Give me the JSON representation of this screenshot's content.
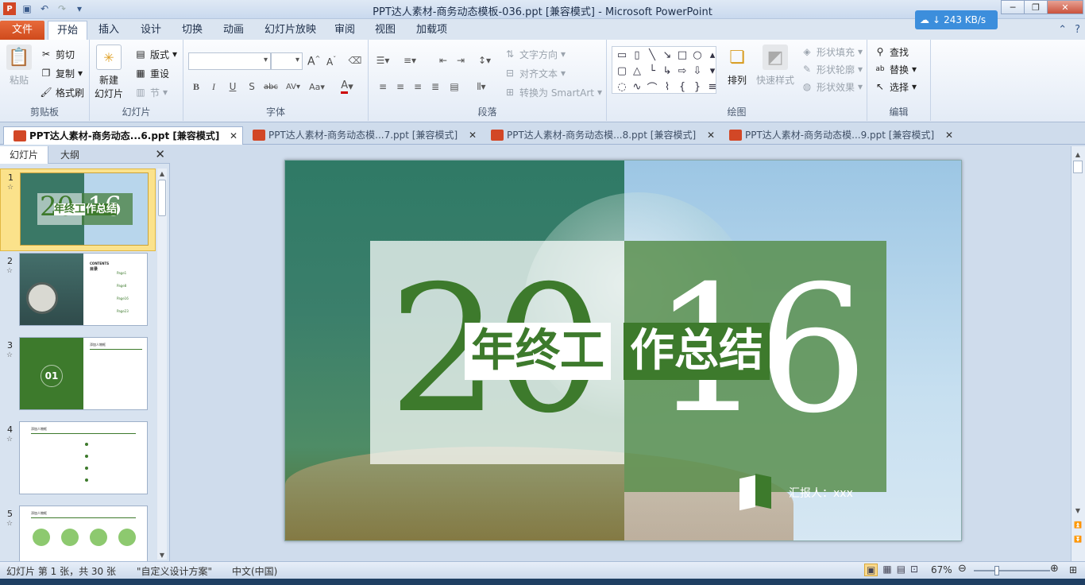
{
  "window": {
    "title": "PPT达人素材-商务动态模板-036.ppt [兼容模式]  -  Microsoft PowerPoint",
    "net_speed": "243 KB/s",
    "buttons": {
      "minimize": "─",
      "maximize": "❐",
      "close": "✕"
    }
  },
  "ribbon_tabs": [
    "文件",
    "开始",
    "插入",
    "设计",
    "切换",
    "动画",
    "幻灯片放映",
    "审阅",
    "视图",
    "加载项"
  ],
  "ribbon": {
    "clipboard": {
      "label": "剪贴板",
      "paste": "粘贴",
      "cut": "剪切",
      "copy": "复制",
      "format_painter": "格式刷"
    },
    "slides": {
      "label": "幻灯片",
      "new_slide": "新建\n幻灯片",
      "layout": "版式",
      "reset": "重设",
      "section": "节"
    },
    "font": {
      "label": "字体"
    },
    "paragraph": {
      "label": "段落",
      "text_direction": "文字方向",
      "align_text": "对齐文本",
      "smartart": "转换为 SmartArt"
    },
    "drawing": {
      "label": "绘图",
      "arrange": "排列",
      "quick_styles": "快速样式",
      "shape_fill": "形状填充",
      "shape_outline": "形状轮廓",
      "shape_effects": "形状效果"
    },
    "editing": {
      "label": "编辑",
      "find": "查找",
      "replace": "替换",
      "select": "选择"
    }
  },
  "doc_tabs": [
    "PPT达人素材-商务动态...6.ppt [兼容模式]",
    "PPT达人素材-商务动态模...7.ppt [兼容模式]",
    "PPT达人素材-商务动态模...8.ppt [兼容模式]",
    "PPT达人素材-商务动态模...9.ppt [兼容模式]"
  ],
  "pane": {
    "tab_slides": "幻灯片",
    "tab_outline": "大纲"
  },
  "thumbnails": [
    {
      "num": "1",
      "star": "☆"
    },
    {
      "num": "2",
      "star": "☆",
      "contents": "CONTENTS",
      "toc": "目录",
      "pages": [
        "Page1",
        "Page8",
        "Page16",
        "Page23"
      ]
    },
    {
      "num": "3",
      "star": "☆",
      "number": "01",
      "heading": "添加人物框"
    },
    {
      "num": "4",
      "star": "☆",
      "heading": "添加人物框"
    },
    {
      "num": "5",
      "star": "☆",
      "heading": "添加人物框"
    }
  ],
  "slide": {
    "year_left": "20",
    "year_right": "16",
    "title_left": "年终工",
    "title_right": "作总结",
    "reporter": "汇报人：xxx"
  },
  "status": {
    "slide_info": "幻灯片 第 1 张，共 30 张",
    "theme": "\"自定义设计方案\"",
    "language": "中文(中国)",
    "zoom": "67%"
  },
  "colors": {
    "accent_green": "#3d7a2c",
    "file_tab": "#d24726"
  }
}
